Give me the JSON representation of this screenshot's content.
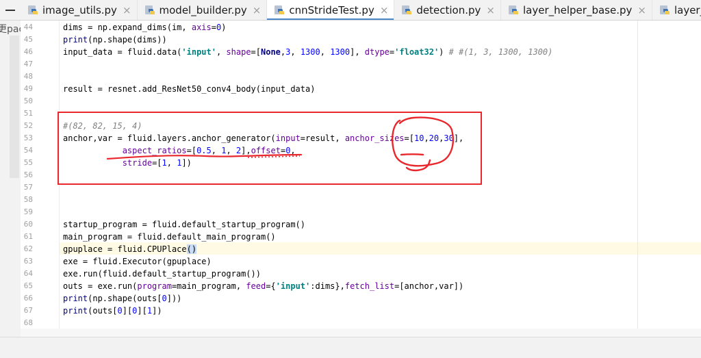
{
  "tabs": [
    {
      "label": "image_utils.py",
      "active": false
    },
    {
      "label": "model_builder.py",
      "active": false
    },
    {
      "label": "cnnStrideTest.py",
      "active": true
    },
    {
      "label": "detection.py",
      "active": false
    },
    {
      "label": "layer_helper_base.py",
      "active": false
    },
    {
      "label": "layer_helper.py",
      "active": false
    }
  ],
  "close_glyph": "×",
  "left_panel_peek": "更pac",
  "line_numbers": [
    "44",
    "45",
    "46",
    "47",
    "48",
    "49",
    "50",
    "51",
    "52",
    "53",
    "54",
    "55",
    "56",
    "57",
    "58",
    "59",
    "60",
    "61",
    "62",
    "63",
    "64",
    "65",
    "66",
    "67",
    "68"
  ],
  "current_line": "62",
  "code_lines": [
    "dims = np.expand_dims(im, axis=0)",
    "print(np.shape(dims))",
    "input_data = fluid.data('input', shape=[None,3, 1300, 1300], dtype='float32') # #(1, 3, 1300, 1300)",
    "",
    "",
    "result = resnet.add_ResNet50_conv4_body(input_data)",
    "",
    "",
    "#(82, 82, 15, 4)",
    "anchor,var = fluid.layers.anchor_generator(input=result, anchor_sizes=[10,20,30],",
    "            aspect_ratios=[0.5, 1, 2],offset=0,",
    "            stride=[1, 1])",
    "",
    "",
    "",
    "",
    "startup_program = fluid.default_startup_program()",
    "main_program = fluid.default_main_program()",
    "gpuplace = fluid.CPUPlace()",
    "exe = fluid.Executor(gpuplace)",
    "exe.run(fluid.default_startup_program())",
    "outs = exe.run(program=main_program, feed={'input':dims},fetch_list=[anchor,var])",
    "print(np.shape(outs[0]))",
    "print(outs[0][0][1])",
    ""
  ],
  "colors": {
    "annotation_red": "#e8282d",
    "active_tab_underline": "#4a88c7",
    "current_line_bg": "#fffae3"
  },
  "icons": [
    "python-file-icon",
    "close-icon"
  ]
}
